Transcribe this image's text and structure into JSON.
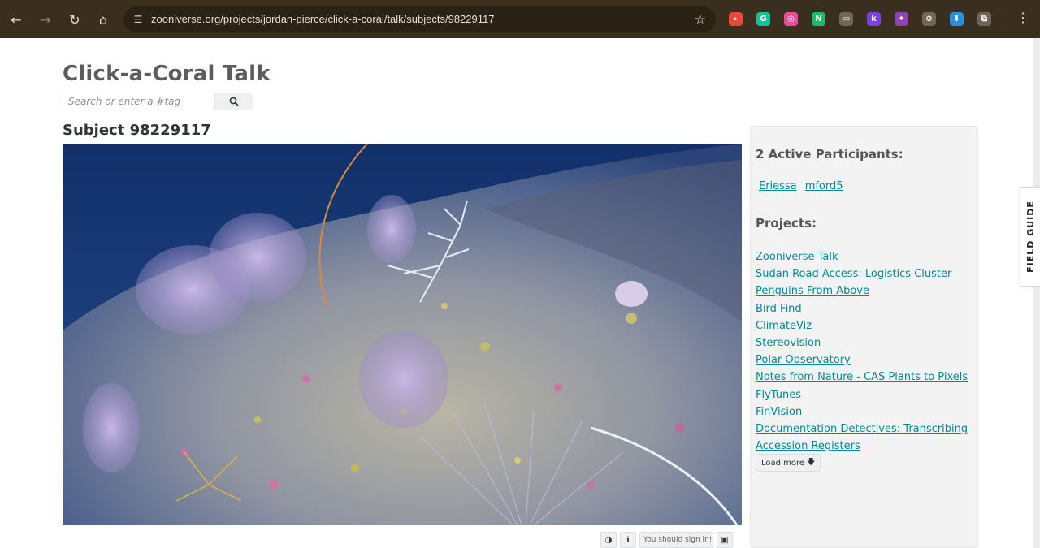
{
  "browser": {
    "url": "zooniverse.org/projects/jordan-pierce/click-a-coral/talk/subjects/98229117",
    "back_icon": "arrow-left-icon",
    "forward_icon": "arrow-right-icon",
    "reload_icon": "reload-icon",
    "home_icon": "home-icon",
    "bookmark_icon": "star-icon",
    "extensions": [
      {
        "name": "extension-red-icon",
        "color": "#e9473a",
        "glyph": "▸"
      },
      {
        "name": "extension-grammarly-icon",
        "color": "#15c39a",
        "glyph": "G"
      },
      {
        "name": "extension-colorful-icon",
        "color": "#e84c9b",
        "glyph": "◎"
      },
      {
        "name": "extension-green-n-icon",
        "color": "#1fb86e",
        "glyph": "N"
      },
      {
        "name": "extension-window-icon",
        "color": "#6f6657",
        "glyph": "▭"
      },
      {
        "name": "extension-purple-k-icon",
        "color": "#7c3fe0",
        "glyph": "k"
      },
      {
        "name": "extension-puzzle-purple-icon",
        "color": "#8e44ad",
        "glyph": "✦"
      },
      {
        "name": "extension-slash-icon",
        "color": "#6f6657",
        "glyph": "⊘"
      },
      {
        "name": "extension-download-blue-icon",
        "color": "#2b8fe0",
        "glyph": "⬇"
      },
      {
        "name": "extensions-puzzle-icon",
        "color": "#6f6657",
        "glyph": "⧉"
      }
    ],
    "menu_icon": "kebab-menu-icon"
  },
  "page": {
    "title": "Click-a-Coral Talk",
    "search_placeholder": "Search or enter a #tag",
    "search_icon": "search-icon",
    "subject_title": "Subject 98229117"
  },
  "image_tools": {
    "invert_icon": "contrast-icon",
    "info_icon": "info-icon",
    "signin_text": "You should sign in!",
    "image_icon": "image-icon"
  },
  "sidebar": {
    "participants_heading": "2 Active Participants:",
    "participants": [
      "Eriessa",
      "mford5"
    ],
    "projects_heading": "Projects:",
    "projects": [
      "Zooniverse Talk",
      "Sudan Road Access: Logistics Cluster",
      "Penguins From Above",
      "Bird Find",
      "ClimateViz",
      "Stereovision",
      "Polar Observatory",
      "Notes from Nature - CAS Plants to Pixels",
      "FlyTunes",
      "FinVision",
      "Documentation Detectives: Transcribing",
      "Accession Registers"
    ],
    "load_more": "Load more",
    "load_more_icon": "arrow-down-icon"
  },
  "field_guide": {
    "label": "FIELD GUIDE"
  }
}
